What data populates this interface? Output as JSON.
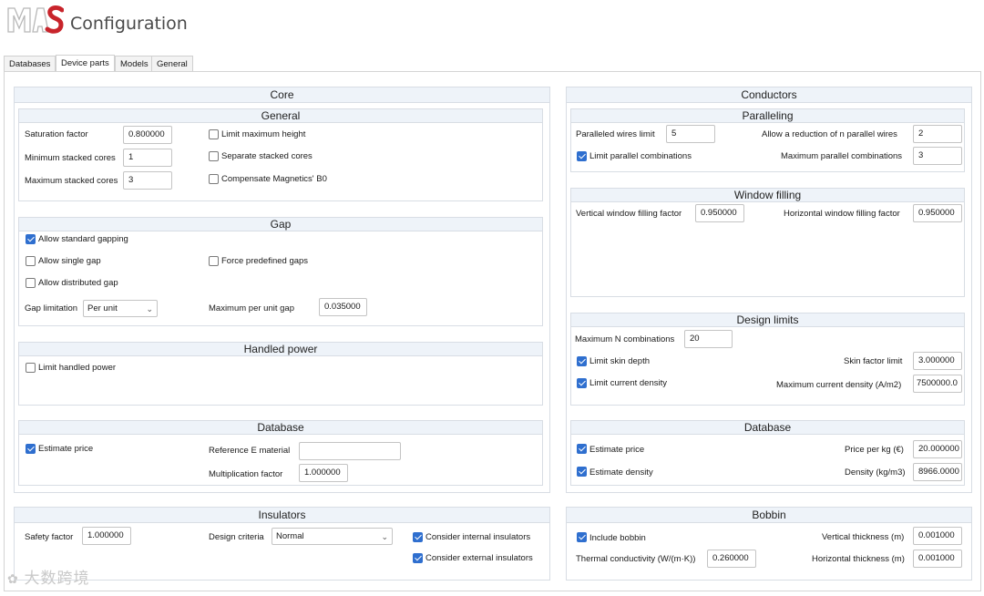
{
  "header": {
    "title": "Configuration",
    "logo_text": "MAS"
  },
  "tabs": [
    "Databases",
    "Device parts",
    "Models",
    "General"
  ],
  "core": {
    "title": "Core",
    "general": {
      "title": "General",
      "saturation_factor_label": "Saturation factor",
      "saturation_factor": "0.800000",
      "min_stacked_label": "Minimum stacked cores",
      "min_stacked": "1",
      "max_stacked_label": "Maximum stacked cores",
      "max_stacked": "3",
      "limit_max_height": "Limit maximum height",
      "separate_stacked": "Separate stacked cores",
      "compensate_b0": "Compensate Magnetics' B0"
    },
    "gap": {
      "title": "Gap",
      "allow_standard": "Allow standard gapping",
      "allow_single": "Allow single gap",
      "force_predefined": "Force predefined gaps",
      "allow_distributed": "Allow distributed gap",
      "gap_limitation_label": "Gap limitation",
      "gap_limitation": "Per unit",
      "max_per_unit_label": "Maximum per unit gap",
      "max_per_unit": "0.035000"
    },
    "handled_power": {
      "title": "Handled power",
      "limit_handled": "Limit handled power"
    },
    "database": {
      "title": "Database",
      "estimate_price": "Estimate price",
      "reference_e_label": "Reference E material",
      "reference_e": "",
      "multiplication_label": "Multiplication factor",
      "multiplication": "1.000000"
    }
  },
  "insulators": {
    "title": "Insulators",
    "safety_label": "Safety factor",
    "safety": "1.000000",
    "design_criteria_label": "Design criteria",
    "design_criteria": "Normal",
    "consider_internal": "Consider internal insulators",
    "consider_external": "Consider external insulators"
  },
  "conductors": {
    "title": "Conductors",
    "paralleling": {
      "title": "Paralleling",
      "paralleled_limit_label": "Paralleled wires limit",
      "paralleled_limit": "5",
      "allow_reduction_label": "Allow a reduction of n parallel wires",
      "allow_reduction": "2",
      "limit_parallel": "Limit parallel combinations",
      "max_parallel_label": "Maximum parallel combinations",
      "max_parallel": "3"
    },
    "window_filling": {
      "title": "Window filling",
      "vertical_label": "Vertical window filling factor",
      "vertical": "0.950000",
      "horizontal_label": "Horizontal window filling factor",
      "horizontal": "0.950000"
    },
    "design_limits": {
      "title": "Design limits",
      "max_n_label": "Maximum N combinations",
      "max_n": "20",
      "limit_skin": "Limit skin depth",
      "skin_factor_label": "Skin factor limit",
      "skin_factor": "3.000000",
      "limit_current": "Limit current density",
      "max_current_label": "Maximum current density (A/m2)",
      "max_current": "7500000.0"
    },
    "database": {
      "title": "Database",
      "estimate_price": "Estimate price",
      "price_per_kg_label": "Price per kg (€)",
      "price_per_kg": "20.000000",
      "estimate_density": "Estimate density",
      "density_label": "Density (kg/m3)",
      "density": "8966.0000"
    }
  },
  "bobbin": {
    "title": "Bobbin",
    "include_bobbin": "Include bobbin",
    "vertical_thickness_label": "Vertical thickness (m)",
    "vertical_thickness": "0.001000",
    "thermal_label": "Thermal conductivity (W/(m·K))",
    "thermal": "0.260000",
    "horizontal_thickness_label": "Horizontal thickness (m)",
    "horizontal_thickness": "0.001000"
  },
  "watermark": "大数跨境"
}
